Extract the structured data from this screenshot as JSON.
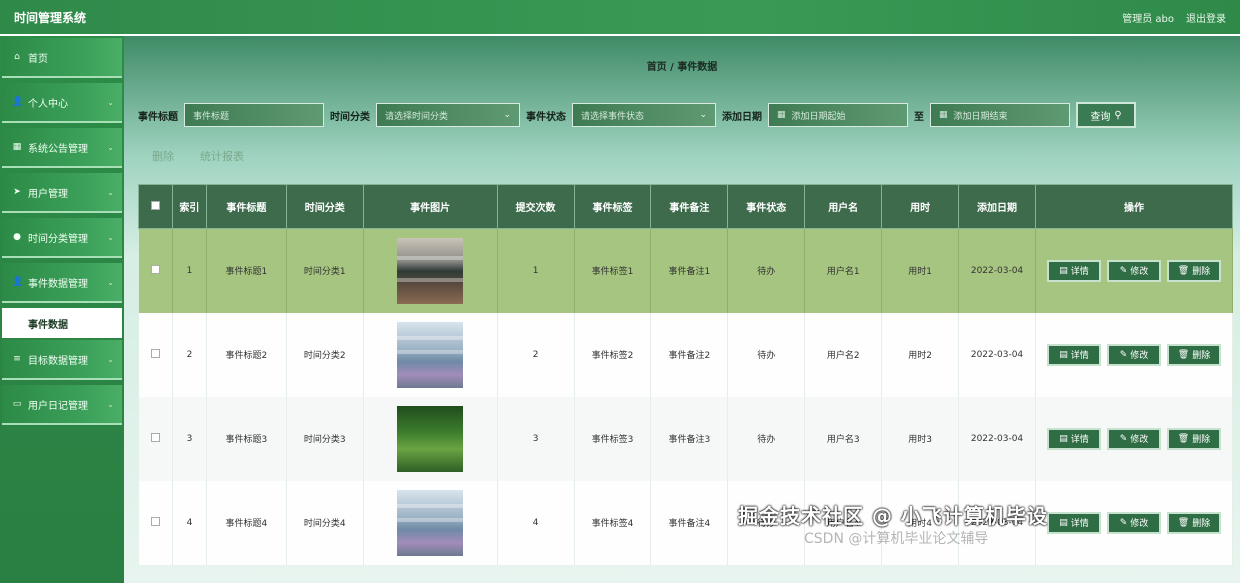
{
  "header": {
    "title": "时间管理系统",
    "admin_label": "管理员",
    "admin_name": "abo",
    "logout": "退出登录"
  },
  "sidebar": {
    "items": [
      {
        "label": "首页",
        "icon": "home-icon",
        "glyph": "⌂"
      },
      {
        "label": "个人中心",
        "icon": "user-icon",
        "glyph": "👤",
        "chev": "⌄"
      },
      {
        "label": "系统公告管理",
        "icon": "grid-icon",
        "glyph": "▦",
        "chev": "⌄"
      },
      {
        "label": "用户管理",
        "icon": "send-icon",
        "glyph": "➤",
        "chev": "⌄"
      },
      {
        "label": "时间分类管理",
        "icon": "pin-icon",
        "glyph": "●",
        "chev": "⌄"
      },
      {
        "label": "事件数据管理",
        "icon": "user-icon",
        "glyph": "👤",
        "chev": "⌄"
      }
    ],
    "sub_item": "事件数据",
    "items_after": [
      {
        "label": "目标数据管理",
        "icon": "list-icon",
        "glyph": "≡",
        "chev": "⌄"
      },
      {
        "label": "用户日记管理",
        "icon": "doc-icon",
        "glyph": "▭",
        "chev": "⌄"
      }
    ]
  },
  "breadcrumb": {
    "home": "首页",
    "sep": "/",
    "current": "事件数据"
  },
  "search": {
    "title_label": "事件标题",
    "title_placeholder": "事件标题",
    "category_label": "时间分类",
    "category_placeholder": "请选择时间分类",
    "status_label": "事件状态",
    "status_placeholder": "请选择事件状态",
    "date_label": "添加日期",
    "date_start_placeholder": "添加日期起始",
    "date_to": "至",
    "date_end_placeholder": "添加日期结束",
    "query_label": "查询"
  },
  "actions": {
    "delete": "删除",
    "report": "统计报表"
  },
  "table": {
    "headers": [
      "索引",
      "事件标题",
      "时间分类",
      "事件图片",
      "提交次数",
      "事件标签",
      "事件备注",
      "事件状态",
      "用户名",
      "用时",
      "添加日期",
      "操作"
    ],
    "rows": [
      {
        "index": "1",
        "title": "事件标题1",
        "category": "时间分类1",
        "image": "classroom",
        "count": "1",
        "tag": "事件标签1",
        "note": "事件备注1",
        "status": "待办",
        "user": "用户名1",
        "duration": "用时1",
        "date": "2022-03-04"
      },
      {
        "index": "2",
        "title": "事件标题2",
        "category": "时间分类2",
        "image": "building",
        "count": "2",
        "tag": "事件标签2",
        "note": "事件备注2",
        "status": "待办",
        "user": "用户名2",
        "duration": "用时2",
        "date": "2022-03-04"
      },
      {
        "index": "3",
        "title": "事件标题3",
        "category": "时间分类3",
        "image": "garden",
        "count": "3",
        "tag": "事件标签3",
        "note": "事件备注3",
        "status": "待办",
        "user": "用户名3",
        "duration": "用时3",
        "date": "2022-03-04"
      },
      {
        "index": "4",
        "title": "事件标题4",
        "category": "时间分类4",
        "image": "building",
        "count": "4",
        "tag": "事件标签4",
        "note": "事件备注4",
        "status": "待办",
        "user": "用户名4",
        "duration": "用时4",
        "date": "2022-03-04"
      }
    ],
    "btn_detail": "详情",
    "btn_edit": "修改",
    "btn_delete": "删除"
  },
  "watermark": {
    "line1": "掘金技术社区 @ 小飞计算机毕设",
    "line2": "CSDN @计算机毕业论文辅导"
  }
}
